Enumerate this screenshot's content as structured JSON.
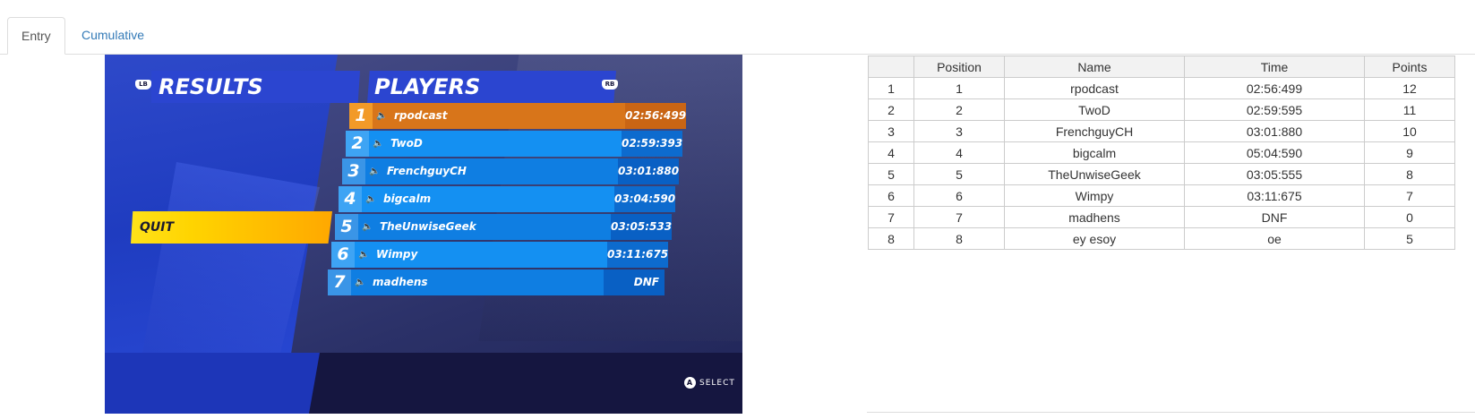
{
  "tabs": [
    {
      "label": "Entry",
      "active": true
    },
    {
      "label": "Cumulative",
      "active": false
    }
  ],
  "game": {
    "results_header": "RESULTS",
    "players_header": "PLAYERS",
    "lb_label": "LB",
    "rb_label": "RB",
    "quit_label": "QUIT",
    "select_button": "A",
    "select_label": "SELECT",
    "rows": [
      {
        "pos": "1",
        "name": "rpodcast",
        "time": "02:56:499"
      },
      {
        "pos": "2",
        "name": "TwoD",
        "time": "02:59:393"
      },
      {
        "pos": "3",
        "name": "FrenchguyCH",
        "time": "03:01:880"
      },
      {
        "pos": "4",
        "name": "bigcalm",
        "time": "03:04:590"
      },
      {
        "pos": "5",
        "name": "TheUnwiseGeek",
        "time": "03:05:533"
      },
      {
        "pos": "6",
        "name": "Wimpy",
        "time": "03:11:675"
      },
      {
        "pos": "7",
        "name": "madhens",
        "time": "DNF"
      }
    ]
  },
  "table": {
    "headers": [
      "",
      "Position",
      "Name",
      "Time",
      "Points"
    ],
    "rows": [
      [
        "1",
        "1",
        "rpodcast",
        "02:56:499",
        "12"
      ],
      [
        "2",
        "2",
        "TwoD",
        "02:59:595",
        "11"
      ],
      [
        "3",
        "3",
        "FrenchguyCH",
        "03:01:880",
        "10"
      ],
      [
        "4",
        "4",
        "bigcalm",
        "05:04:590",
        "9"
      ],
      [
        "5",
        "5",
        "TheUnwiseGeek",
        "03:05:555",
        "8"
      ],
      [
        "6",
        "6",
        "Wimpy",
        "03:11:675",
        "7"
      ],
      [
        "7",
        "7",
        "madhens",
        "DNF",
        "0"
      ],
      [
        "8",
        "8",
        "ey esoy",
        "oe",
        "5"
      ]
    ]
  },
  "colors": {
    "tab_link": "#337ab7",
    "first_row": "#d8751a",
    "row_blue": "#1490f2",
    "quit_yellow": "#ffd400"
  }
}
